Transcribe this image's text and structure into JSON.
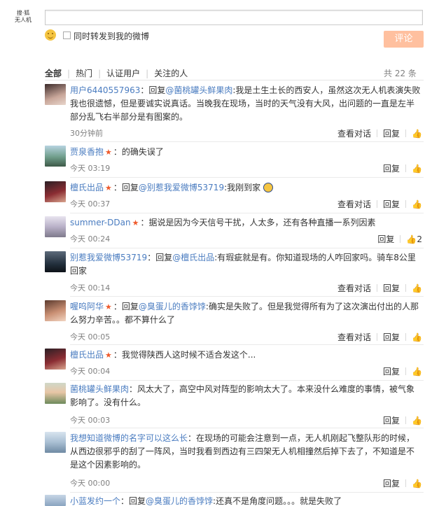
{
  "logo": {
    "line1": "搜·狐",
    "line2": "无人机"
  },
  "composer": {
    "placeholder": ""
  },
  "repost_label": "同时转发到我的微博",
  "submit_label": "评论",
  "filters": [
    "全部",
    "热门",
    "认证用户",
    "关注的人"
  ],
  "count_text": "共 22 条",
  "view_label": "查看对话",
  "reply_label": "回复",
  "comments": [
    {
      "name": "用户6440557963",
      "prefix": "：回复",
      "mention": "@菌桃罐头鲜果肉",
      "text": ":我是土生土长的西安人，虽然这次无人机表演失败我也很遗憾，但是要诚实说真话。当晚我在现场，当时的天气没有大风，出问题的一直是左半部分乱飞右半部分是有图案的。",
      "time": "30分钟前",
      "likes": ""
    },
    {
      "name": "贾泉香抱",
      "prefix": "",
      "mention": "",
      "text": "：的确失误了",
      "time": "今天 03:19",
      "likes": ""
    },
    {
      "name": "檀氏出品",
      "prefix": "：回复",
      "mention": "@别惹我爱微博53719",
      "text": ":我刚到家",
      "time": "今天 00:37",
      "likes": ""
    },
    {
      "name": "summer-DDan",
      "prefix": "",
      "mention": "",
      "text": "：据说是因为今天信号干扰，人太多，还有各种直播一系列因素",
      "time": "今天 00:24",
      "likes": "2"
    },
    {
      "name": "别惹我爱微博53719",
      "prefix": "：回复",
      "mention": "@檀氏出品",
      "text": ":有瑕疵就是有。你知道现场的人咋回家吗。骑车8公里回家",
      "time": "今天 00:14",
      "likes": ""
    },
    {
      "name": "喔呜阿华",
      "prefix": "：回复",
      "mention": "@臭蛋儿的香饽饽",
      "text": ":确实是失败了。但是我觉得所有为了这次演出付出的人那么努力辛苦。。都不算什么了",
      "time": "今天 00:05",
      "likes": ""
    },
    {
      "name": "檀氏出品",
      "prefix": "",
      "mention": "",
      "text": "：我觉得陕西人这时候不适合发这个...",
      "time": "今天 00:04",
      "likes": ""
    },
    {
      "name": "菌桃罐头鲜果肉",
      "prefix": "",
      "mention": "",
      "text": "：风太大了，高空中风对阵型的影响太大了。本来没什么难度的事情，被气象影响了。没有什么。",
      "time": "今天 00:03",
      "likes": ""
    },
    {
      "name": "我想知道微博的名字可以这么长",
      "prefix": "",
      "mention": "",
      "text": "：在现场的可能会注意到一点，无人机刚起飞整队形的时候，从西边很邪乎的刮了一阵风，当时我看到西边有三四架无人机相撞然后掉下去了，不知道是不是这个因素影响的。",
      "time": "今天 00:00",
      "likes": ""
    },
    {
      "name": "小蓝发约一个",
      "prefix": "：回复",
      "mention": "@臭蛋儿的香饽饽",
      "text": ":还真不是角度问题。。。就是失败了",
      "time": "",
      "likes": ""
    }
  ],
  "colors": {
    "link": "#4a7cc0",
    "button": "#ffc09f",
    "vip": "#ef5a2b"
  }
}
